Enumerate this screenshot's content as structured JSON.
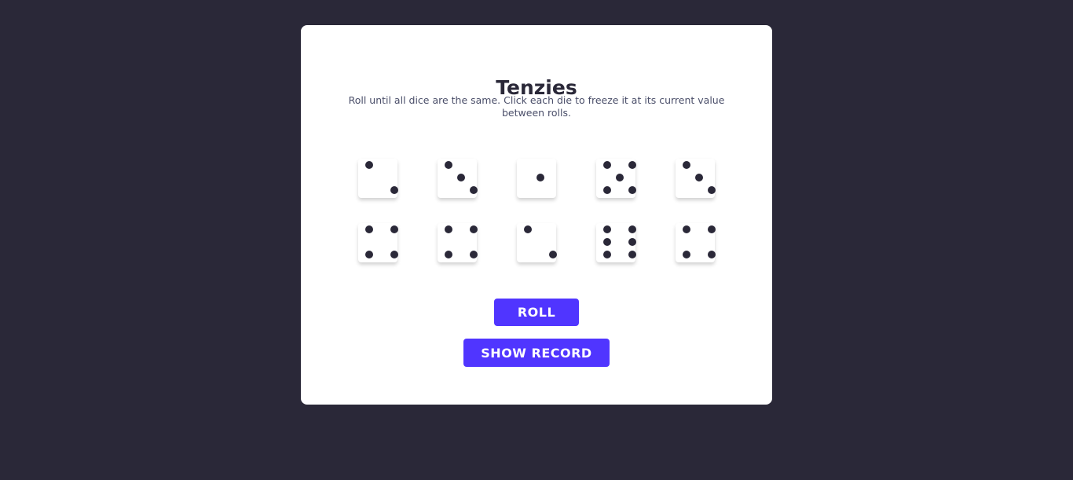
{
  "app": {
    "title": "Tenzies",
    "instructions": "Roll until all dice are the same. Click each die to freeze it at its current value between rolls."
  },
  "dice": [
    {
      "value": 2,
      "held": false
    },
    {
      "value": 3,
      "held": false
    },
    {
      "value": 1,
      "held": false
    },
    {
      "value": 5,
      "held": false
    },
    {
      "value": 3,
      "held": false
    },
    {
      "value": 4,
      "held": false
    },
    {
      "value": 4,
      "held": false
    },
    {
      "value": 2,
      "held": false
    },
    {
      "value": 6,
      "held": false
    },
    {
      "value": 4,
      "held": false
    }
  ],
  "buttons": {
    "roll_label": "ROLL",
    "show_record_label": "SHOW RECORD"
  },
  "colors": {
    "background": "#2a2838",
    "card": "#ffffff",
    "pip": "#2a2838",
    "accent": "#5035ff"
  }
}
